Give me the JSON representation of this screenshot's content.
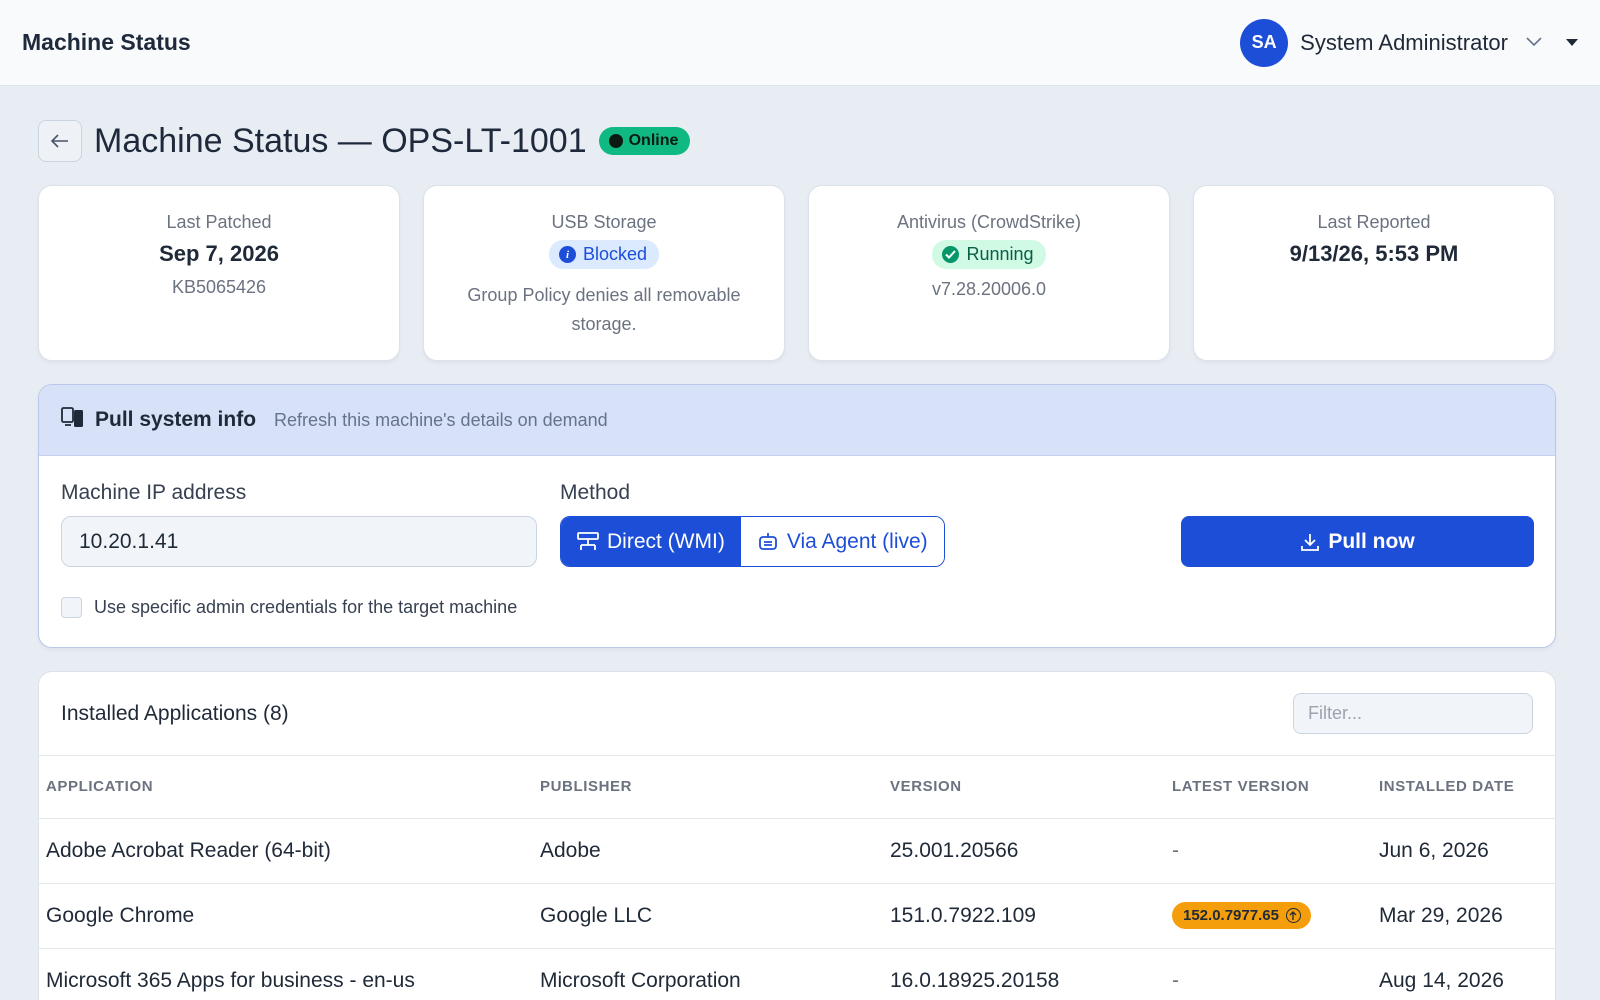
{
  "header": {
    "app_title": "Machine Status",
    "user": {
      "initials": "SA",
      "name": "System Administrator"
    }
  },
  "page": {
    "title": "Machine Status — OPS-LT-1001",
    "status": "Online",
    "status_color": "#10b981"
  },
  "cards": {
    "last_patched": {
      "label": "Last Patched",
      "value": "Sep 7, 2026",
      "sub": "KB5065426"
    },
    "usb": {
      "label": "USB Storage",
      "badge": "Blocked",
      "description": "Group Policy denies all removable storage."
    },
    "antivirus": {
      "label": "Antivirus (CrowdStrike)",
      "badge": "Running",
      "sub": "v7.28.20006.0"
    },
    "last_reported": {
      "label": "Last Reported",
      "value": "9/13/26, 5:53 PM"
    }
  },
  "pull": {
    "title": "Pull system info",
    "subtitle": "Refresh this machine's details on demand",
    "ip_label": "Machine IP address",
    "ip_value": "10.20.1.41",
    "method_label": "Method",
    "method_direct": "Direct (WMI)",
    "method_agent": "Via Agent (live)",
    "selected_method": "Direct (WMI)",
    "pull_button": "Pull now",
    "credentials_label": "Use specific admin credentials for the target machine",
    "credentials_checked": false
  },
  "apps": {
    "title": "Installed Applications (8)",
    "filter_placeholder": "Filter...",
    "columns": [
      "APPLICATION",
      "PUBLISHER",
      "VERSION",
      "LATEST VERSION",
      "INSTALLED DATE"
    ],
    "rows": [
      {
        "application": "Adobe Acrobat Reader (64-bit)",
        "publisher": "Adobe",
        "version": "25.001.20566",
        "latest": "-",
        "installed": "Jun 6, 2026"
      },
      {
        "application": "Google Chrome",
        "publisher": "Google LLC",
        "version": "151.0.7922.109",
        "latest": "152.0.7977.65",
        "installed": "Mar 29, 2026"
      },
      {
        "application": "Microsoft 365 Apps for business - en-us",
        "publisher": "Microsoft Corporation",
        "version": "16.0.18925.20158",
        "latest": "-",
        "installed": "Aug 14, 2026"
      }
    ]
  },
  "colors": {
    "accent": "#1d4ed8",
    "update_badge": "#f59e0b",
    "info_badge_bg": "#dbeafe",
    "ok_badge_bg": "#d1fae5"
  }
}
